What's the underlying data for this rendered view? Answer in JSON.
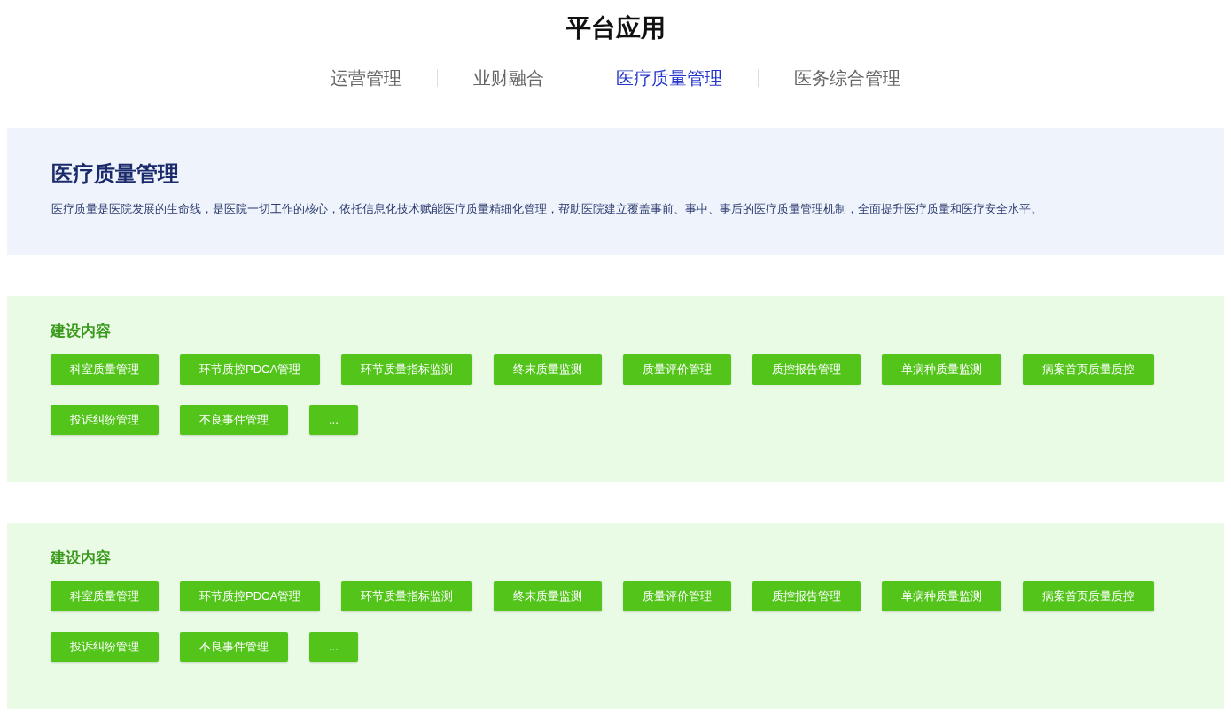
{
  "title": "平台应用",
  "tabs": [
    {
      "label": "运营管理",
      "selected": false
    },
    {
      "label": "业财融合",
      "selected": false
    },
    {
      "label": "医疗质量管理",
      "selected": true
    },
    {
      "label": "医务综合管理",
      "selected": false
    }
  ],
  "intro": {
    "title": "医疗质量管理",
    "description": "医疗质量是医院发展的生命线，是医院一切工作的核心，依托信息化技术赋能医疗质量精细化管理，帮助医院建立覆盖事前、事中、事后的医疗质量管理机制，全面提升医疗质量和医疗安全水平。"
  },
  "sections": [
    {
      "title": "建设内容",
      "items": [
        "科室质量管理",
        "环节质控PDCA管理",
        "环节质量指标监测",
        "终末质量监测",
        "质量评价管理",
        "质控报告管理",
        "单病种质量监测",
        "病案首页质量质控",
        "投诉纠纷管理",
        "不良事件管理",
        "..."
      ]
    },
    {
      "title": "建设内容",
      "items": [
        "科室质量管理",
        "环节质控PDCA管理",
        "环节质量指标监测",
        "终末质量监测",
        "质量评价管理",
        "质控报告管理",
        "单病种质量监测",
        "病案首页质量质控",
        "投诉纠纷管理",
        "不良事件管理",
        "..."
      ]
    }
  ]
}
